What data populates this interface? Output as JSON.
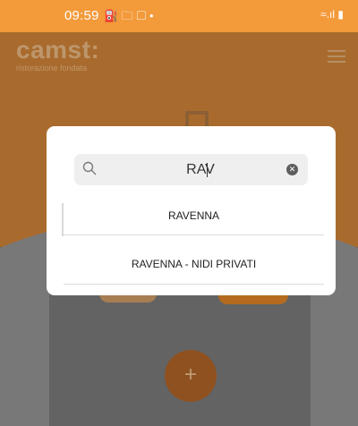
{
  "status": {
    "time": "09:59",
    "icons": "⛽ 🗀 ▢ •",
    "right_icons": "≈.ıl ▮"
  },
  "app": {
    "logo": "camst:",
    "logo_sub": "ristorazione fondata",
    "fab_icon": "+"
  },
  "search": {
    "value": "RAV"
  },
  "results": [
    {
      "label": "RAVENNA"
    },
    {
      "label": "RAVENNA - NIDI PRIVATI"
    }
  ],
  "colors": {
    "accent": "#f39a3a"
  }
}
